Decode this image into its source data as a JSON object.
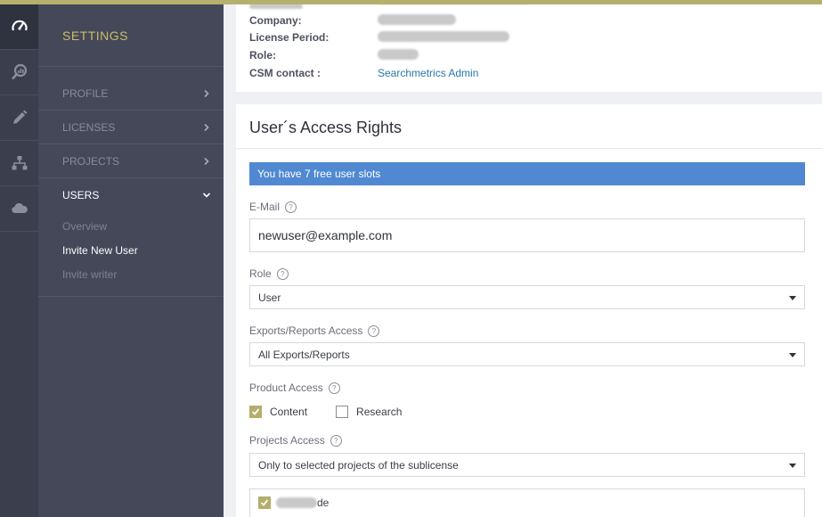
{
  "rail": {
    "icons": [
      "dashboard-icon",
      "research-icon",
      "content-pen-icon",
      "sitemap-icon",
      "cloud-icon"
    ]
  },
  "nav": {
    "title": "SETTINGS",
    "items": [
      {
        "label": "PROFILE"
      },
      {
        "label": "LICENSES"
      },
      {
        "label": "PROJECTS"
      },
      {
        "label": "USERS"
      }
    ],
    "users_sub": [
      {
        "label": "Overview"
      },
      {
        "label": "Invite New User"
      },
      {
        "label": "Invite writer"
      }
    ]
  },
  "account": {
    "company_label": "Company:",
    "license_label": "License Period:",
    "role_label": "Role:",
    "csm_label": "CSM contact :",
    "csm_value": "Searchmetrics Admin"
  },
  "access": {
    "title": "User´s Access Rights",
    "banner": "You have 7 free user slots",
    "email_label": "E-Mail",
    "email_value": "newuser@example.com",
    "role_label": "Role",
    "role_value": "User",
    "exports_label": "Exports/Reports Access",
    "exports_value": "All Exports/Reports",
    "product_label": "Product Access",
    "product_content": "Content",
    "product_research": "Research",
    "projects_label": "Projects Access",
    "projects_value": "Only to selected projects of the sublicense",
    "project_item_suffix": "de"
  },
  "colors": {
    "accent": "#5089d1",
    "gold": "#b5ad6c",
    "sidebar": "#454858",
    "rail": "#3b3e4d"
  }
}
